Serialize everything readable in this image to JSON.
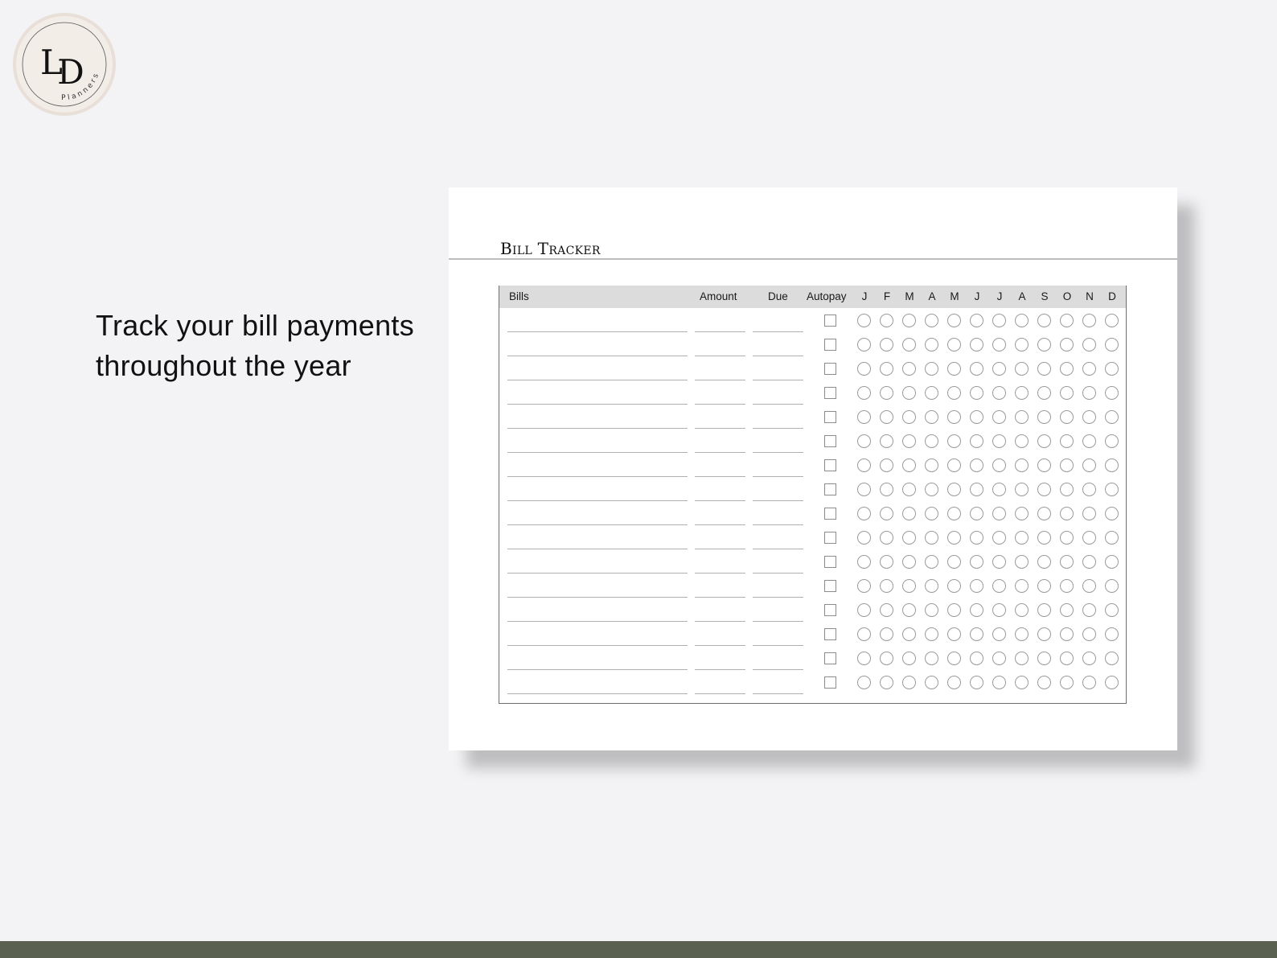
{
  "brand": {
    "monogram": "LD",
    "name": "Planners",
    "colors": {
      "badge_fill": "#efe9e3",
      "ink": "#111111",
      "footer_bar": "#5b6150"
    }
  },
  "tagline": {
    "line1": "Track your bill payments",
    "line2": "throughout the year"
  },
  "sheet": {
    "title": "Bill Tracker",
    "columns": {
      "bills": "Bills",
      "amount": "Amount",
      "due": "Due",
      "autopay": "Autopay",
      "months": [
        "J",
        "F",
        "M",
        "A",
        "M",
        "J",
        "J",
        "A",
        "S",
        "O",
        "N",
        "D"
      ]
    },
    "row_count": 16,
    "icons": {
      "autopay": "checkbox-icon",
      "month": "circle-checkbox-icon"
    }
  }
}
